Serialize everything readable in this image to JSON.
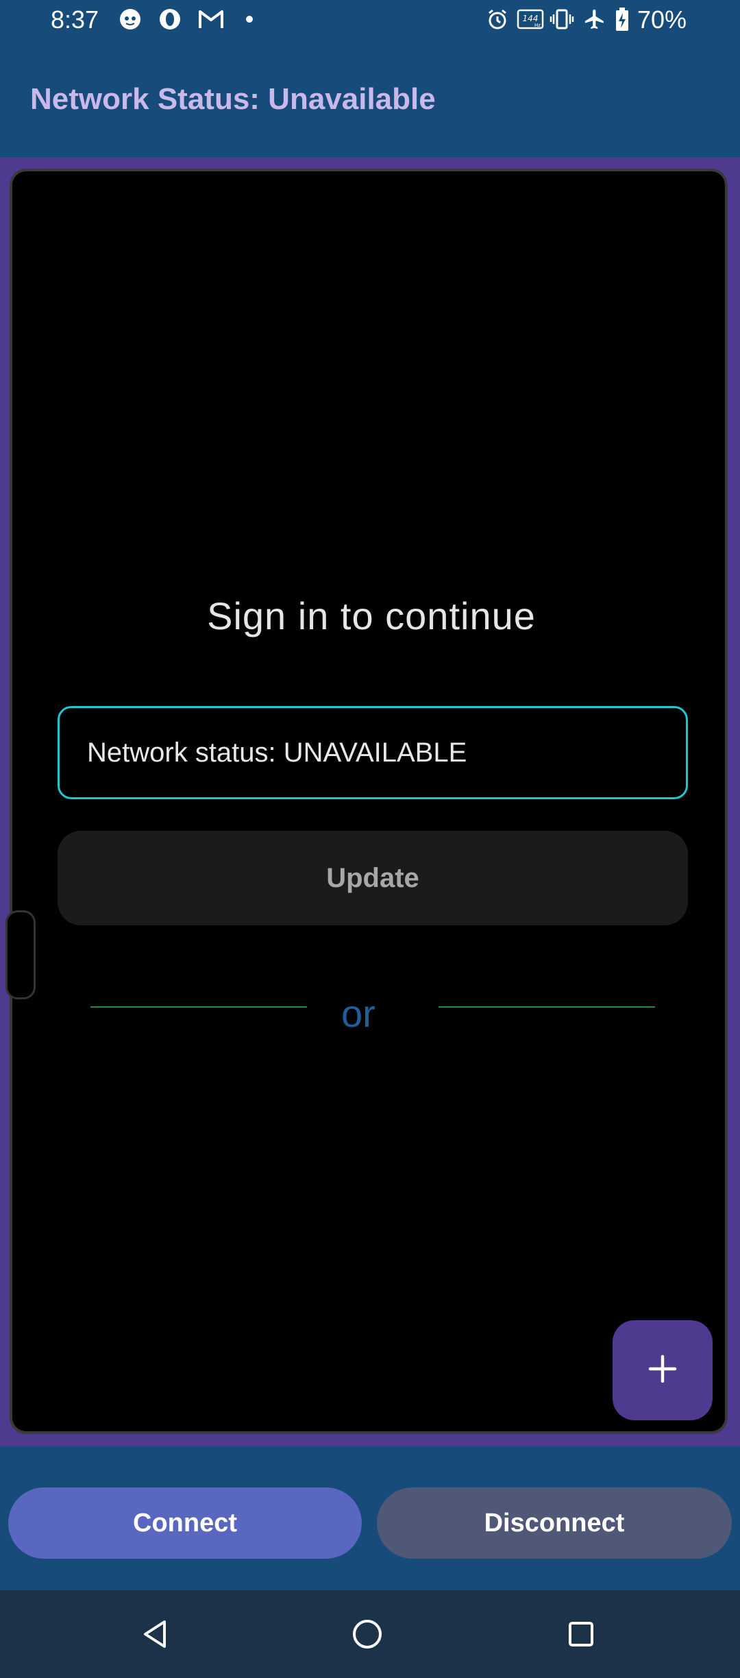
{
  "status_bar": {
    "time": "8:37",
    "battery_percent": "70%",
    "left_icons": [
      "face-notification-icon",
      "opera-icon",
      "gmail-icon",
      "dot-icon"
    ],
    "right_icons": [
      "alarm-icon",
      "refresh-rate-144hz-icon",
      "vibrate-icon",
      "airplane-mode-icon",
      "battery-charging-icon"
    ]
  },
  "app_bar": {
    "title": "Network Status: Unavailable"
  },
  "card": {
    "heading": "Sign in to continue",
    "status_field_value": "Network status: UNAVAILABLE",
    "update_label": "Update",
    "divider_text": "or",
    "fab_icon": "plus-icon"
  },
  "actions": {
    "connect_label": "Connect",
    "disconnect_label": "Disconnect"
  },
  "nav": {
    "back_icon": "back-icon",
    "home_icon": "home-icon",
    "recents_icon": "recents-icon"
  },
  "colors": {
    "app_bar_bg": "#174b79",
    "title_text": "#c9b8ea",
    "frame_purple": "#4e3a8f",
    "input_border": "#1fc7d0",
    "divider_green": "#1d8c2a",
    "or_text": "#1f5e9a",
    "connect_bg": "#5a67c0",
    "disconnect_bg": "#505877",
    "nav_bg": "#1b3248"
  }
}
